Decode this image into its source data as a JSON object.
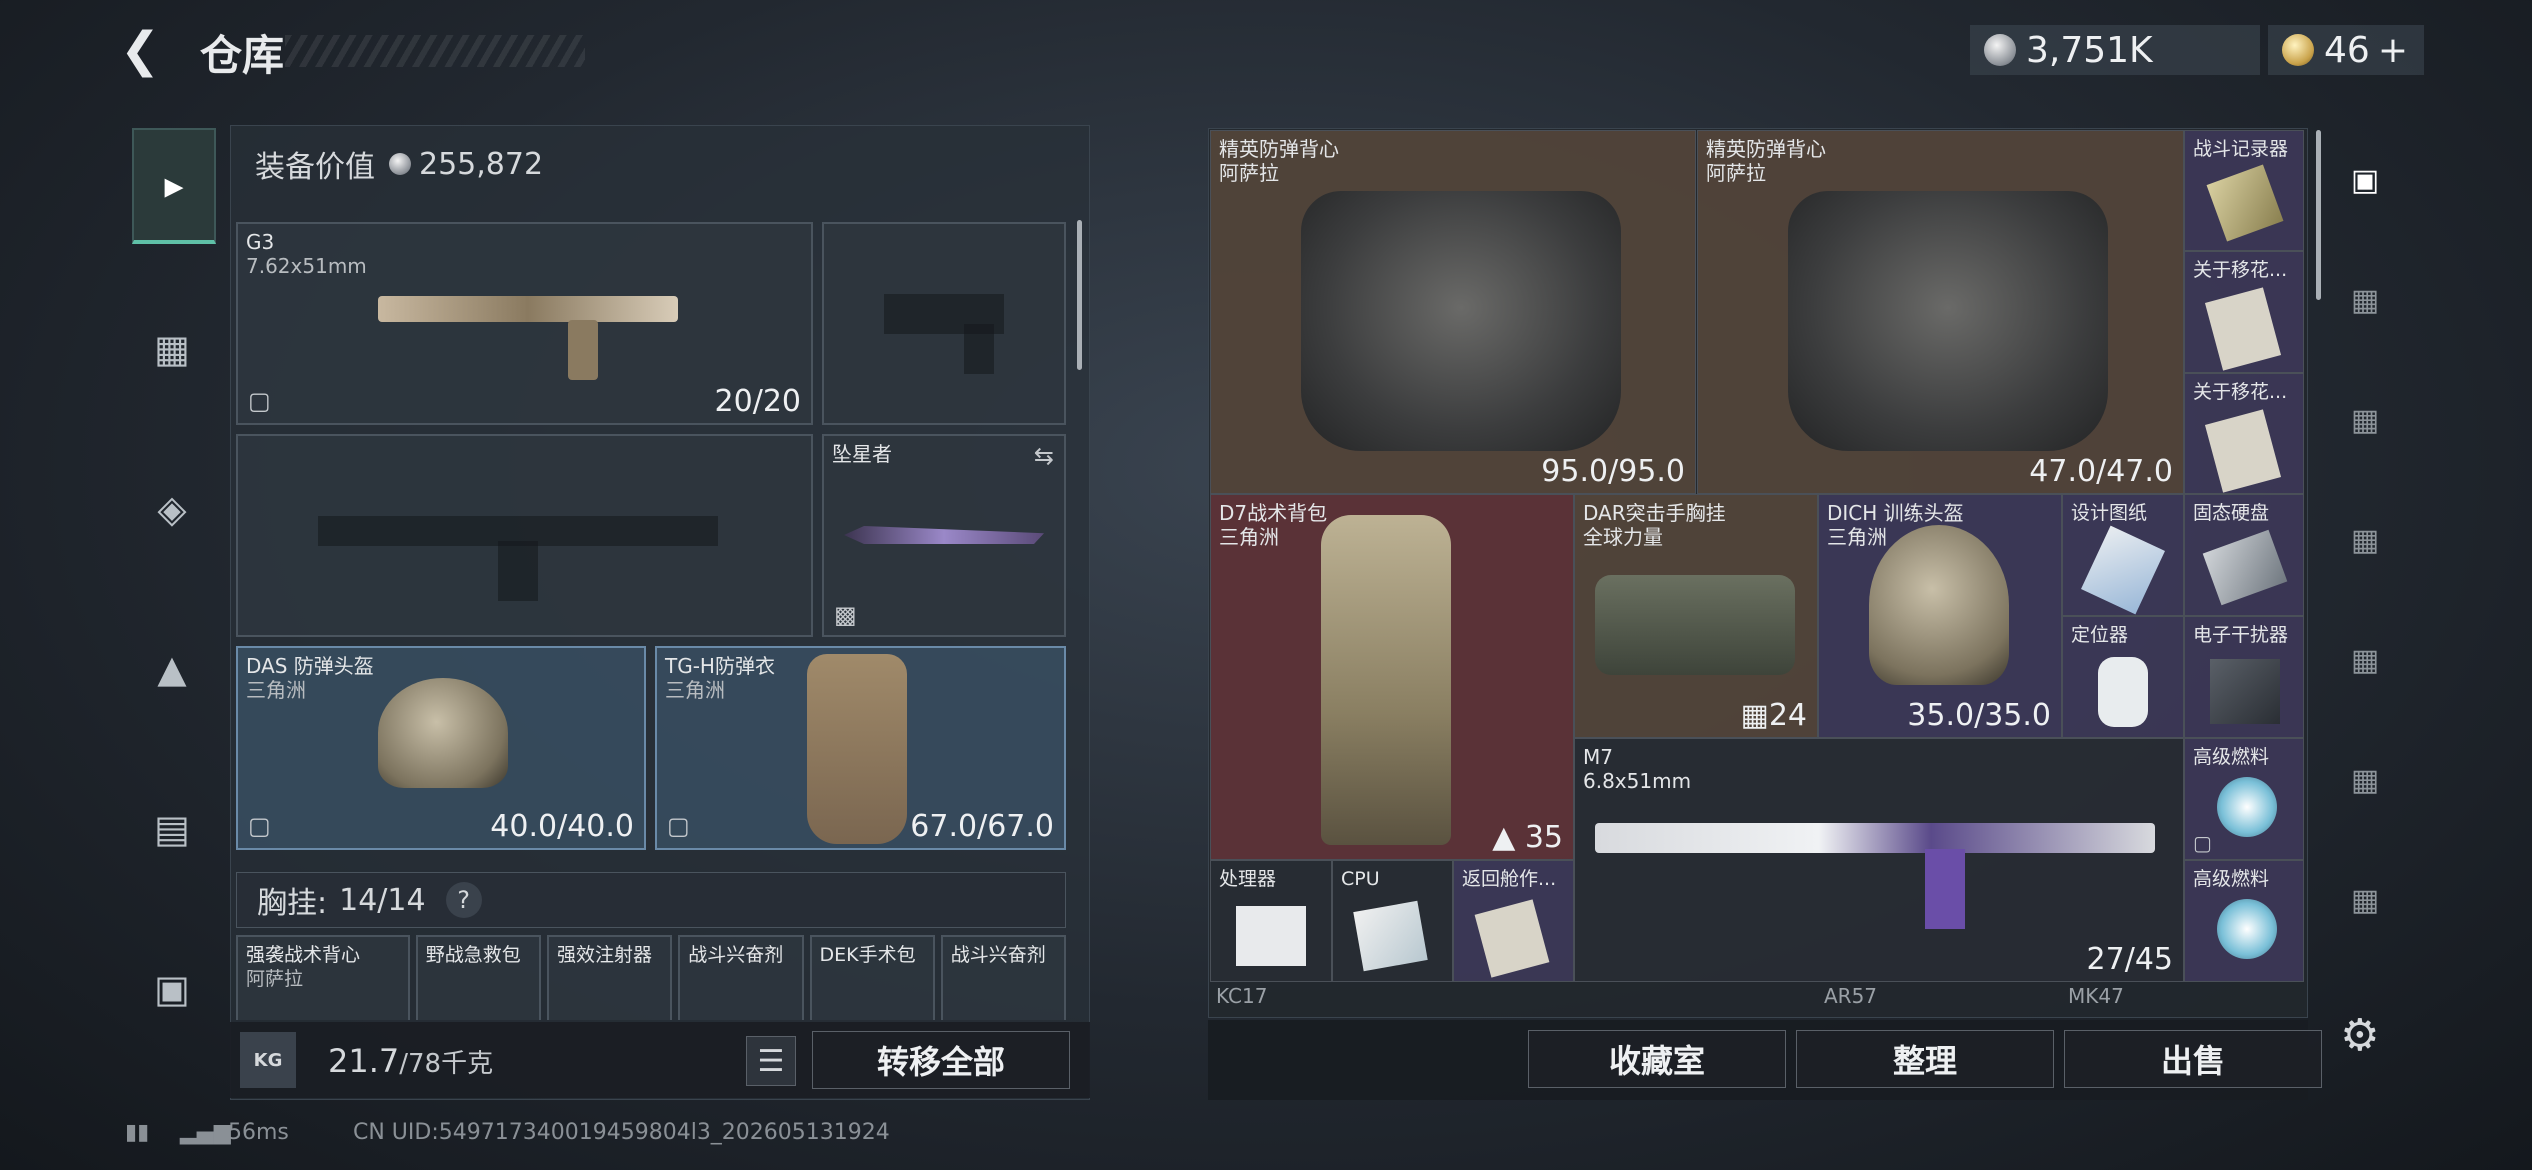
{
  "header": {
    "title": "仓库",
    "currency1": "3,751K",
    "currency2": "46",
    "plus": "+"
  },
  "left": {
    "equip_value_label": "装备价值",
    "equip_value": "255,872",
    "primary": {
      "name": "G3",
      "caliber": "7.62x51mm",
      "ammo": "20/20"
    },
    "melee": {
      "name": "坠星者"
    },
    "helmet": {
      "name": "DAS 防弹头盔",
      "map": "三角洲",
      "durability": "40.0/40.0"
    },
    "armor": {
      "name": "TG-H防弹衣",
      "map": "三角洲",
      "durability": "67.0/67.0"
    },
    "chest": {
      "label": "胸挂:",
      "count": "14/14",
      "help": "?"
    },
    "chest_items": [
      "强袭战术背心",
      "野战急救包",
      "强效注射器",
      "战斗兴奋剂",
      "DEK手术包",
      "战斗兴奋剂"
    ],
    "chest_item0_sub": "阿萨拉",
    "weight": "21.7",
    "weight_max": "/78千克",
    "kg": "KG",
    "transfer_all": "转移全部"
  },
  "grid": {
    "vest1": {
      "name": "精英防弹背心",
      "map": "阿萨拉",
      "durability": "95.0/95.0"
    },
    "vest2": {
      "name": "精英防弹背心",
      "map": "阿萨拉",
      "durability": "47.0/47.0"
    },
    "recorder": "战斗记录器",
    "about1": "关于移花...",
    "about2": "关于移花...",
    "backpack": {
      "name": "D7战术背包",
      "map": "三角洲",
      "count": "35"
    },
    "chestrig": {
      "name": "DAR突击手胸挂",
      "map": "全球力量",
      "count": "24"
    },
    "dich": {
      "name": "DICH 训练头盔",
      "map": "三角洲",
      "durability": "35.0/35.0"
    },
    "blueprint": "设计图纸",
    "ssd": "固态硬盘",
    "locator": "定位器",
    "jammer": "电子干扰器",
    "m7": {
      "name": "M7",
      "caliber": "6.8x51mm",
      "ammo": "27/45"
    },
    "fuel1": "高级燃料",
    "fuel2": "高级燃料",
    "processor": "处理器",
    "cpu": "CPU",
    "return": "返回舱作...",
    "bottom_row": [
      "KC17",
      "AR57",
      "MK47"
    ]
  },
  "buttons": {
    "collection": "收藏室",
    "organize": "整理",
    "sell": "出售"
  },
  "footer": {
    "ping": "56ms",
    "uid": "CN UID:549717340019459804l3_202605131924"
  }
}
